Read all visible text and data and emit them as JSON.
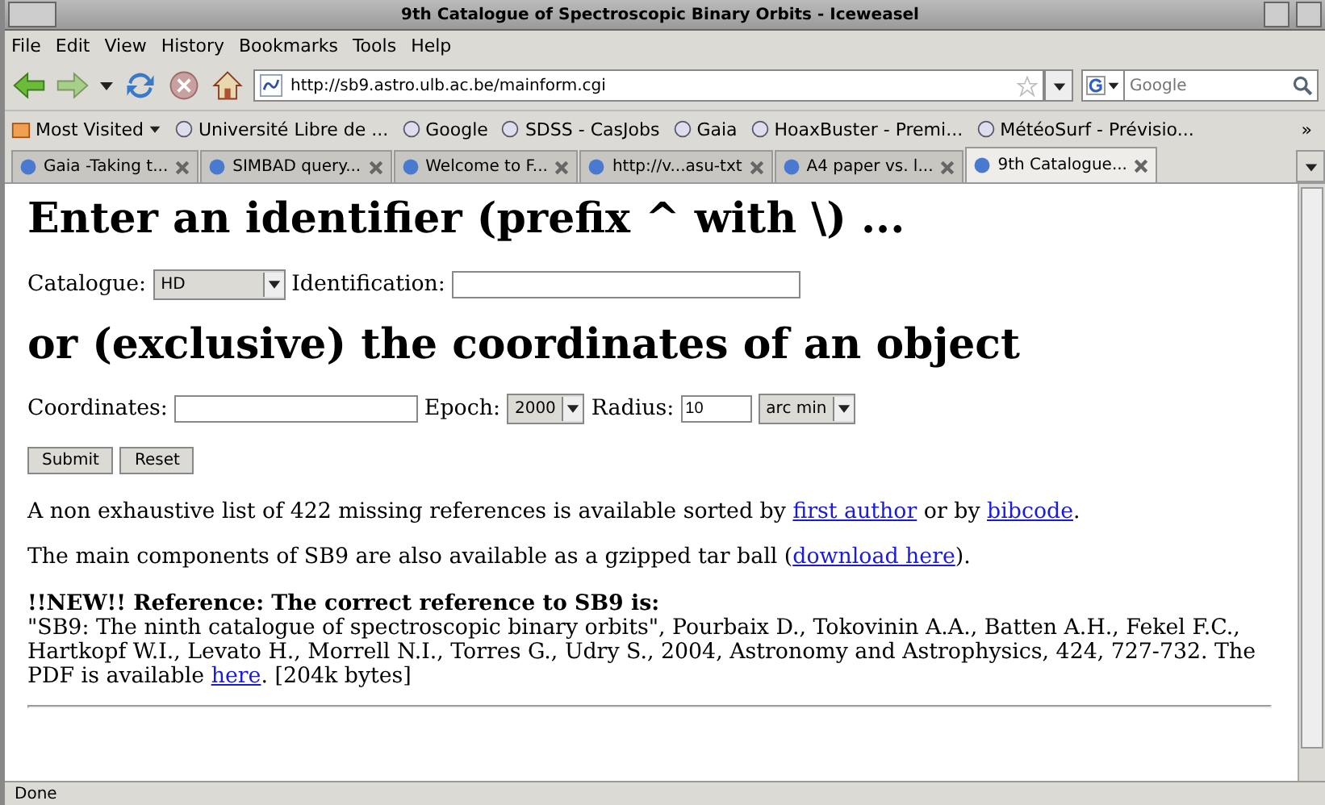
{
  "window": {
    "title": "9th Catalogue of Spectroscopic Binary Orbits - Iceweasel"
  },
  "menu": [
    "File",
    "Edit",
    "View",
    "History",
    "Bookmarks",
    "Tools",
    "Help"
  ],
  "navbar": {
    "url": "http://sb9.astro.ulb.ac.be/mainform.cgi",
    "search_placeholder": "Google"
  },
  "bookmarks": [
    {
      "label": "Most Visited",
      "kind": "menu"
    },
    {
      "label": "Université Libre de ...",
      "kind": "link"
    },
    {
      "label": "Google",
      "kind": "link"
    },
    {
      "label": "SDSS - CasJobs",
      "kind": "link"
    },
    {
      "label": "Gaia",
      "kind": "link"
    },
    {
      "label": "HoaxBuster - Premi...",
      "kind": "link"
    },
    {
      "label": "MétéoSurf - Prévisio...",
      "kind": "link"
    }
  ],
  "bookmarks_overflow": "»",
  "tabs": [
    {
      "label": "Gaia -Taking t...",
      "selected": false
    },
    {
      "label": "SIMBAD query...",
      "selected": false
    },
    {
      "label": "Welcome to F...",
      "selected": false
    },
    {
      "label": "http://v...asu-txt",
      "selected": false
    },
    {
      "label": "A4 paper vs. l...",
      "selected": false
    },
    {
      "label": "9th Catalogue...",
      "selected": true
    }
  ],
  "page": {
    "heading_1": "Enter an identifier (prefix ^ with \\) ...",
    "catalogue_label": "Catalogue:",
    "catalogue_value": "HD",
    "identification_label": "Identification:",
    "heading_2": "or (exclusive) the coordinates of an object",
    "coordinates_label": "Coordinates:",
    "epoch_label": "Epoch:",
    "epoch_value": "2000",
    "radius_label": "Radius:",
    "radius_value": "10",
    "radius_unit": "arc min",
    "buttons": [
      "Submit",
      "Reset"
    ],
    "missing_text": [
      "A non exhaustive list of 422 missing references is available sorted by ",
      "first author",
      " or by ",
      "bibcode",
      "."
    ],
    "tarball_text": [
      "The main components of SB9 are also available as a gzipped tar ball (",
      "download here",
      ")."
    ],
    "reference_heading": "!!NEW!! Reference: The correct reference to SB9 is:",
    "reference_text": [
      "\"SB9: The ninth catalogue of spectroscopic binary orbits\", Pourbaix D., Tokovinin A.A., Batten A.H., Fekel F.C., Hartkopf W.I., Levato H., Morrell N.I., Torres G., Udry S., 2004, Astronomy and Astrophysics, 424, 727-732. The PDF is available ",
      "here",
      ". [204k bytes]"
    ]
  },
  "status_bar": "Done"
}
